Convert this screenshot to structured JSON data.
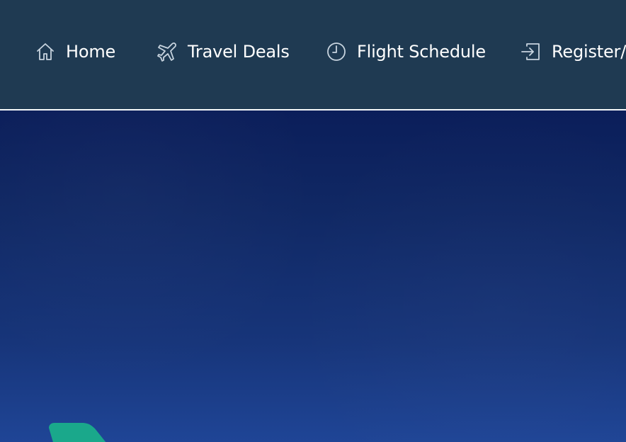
{
  "nav": {
    "items": [
      {
        "id": "home",
        "label": "Home",
        "icon": "home-icon"
      },
      {
        "id": "travel-deals",
        "label": "Travel Deals",
        "icon": "plane-icon"
      },
      {
        "id": "flight-schedule",
        "label": "Flight Schedule",
        "icon": "clock-icon"
      },
      {
        "id": "register-login",
        "label": "Register/L",
        "icon": "login-icon"
      }
    ]
  },
  "colors": {
    "navbar_bg": "#1f3a52",
    "navbar_border": "#f4f7fa",
    "nav_text": "#ffffff",
    "nav_icon": "#c8d4df",
    "hero_top": "#0b1e5a",
    "hero_bottom": "#1f4596",
    "plane_tail": "#1aa88b"
  }
}
